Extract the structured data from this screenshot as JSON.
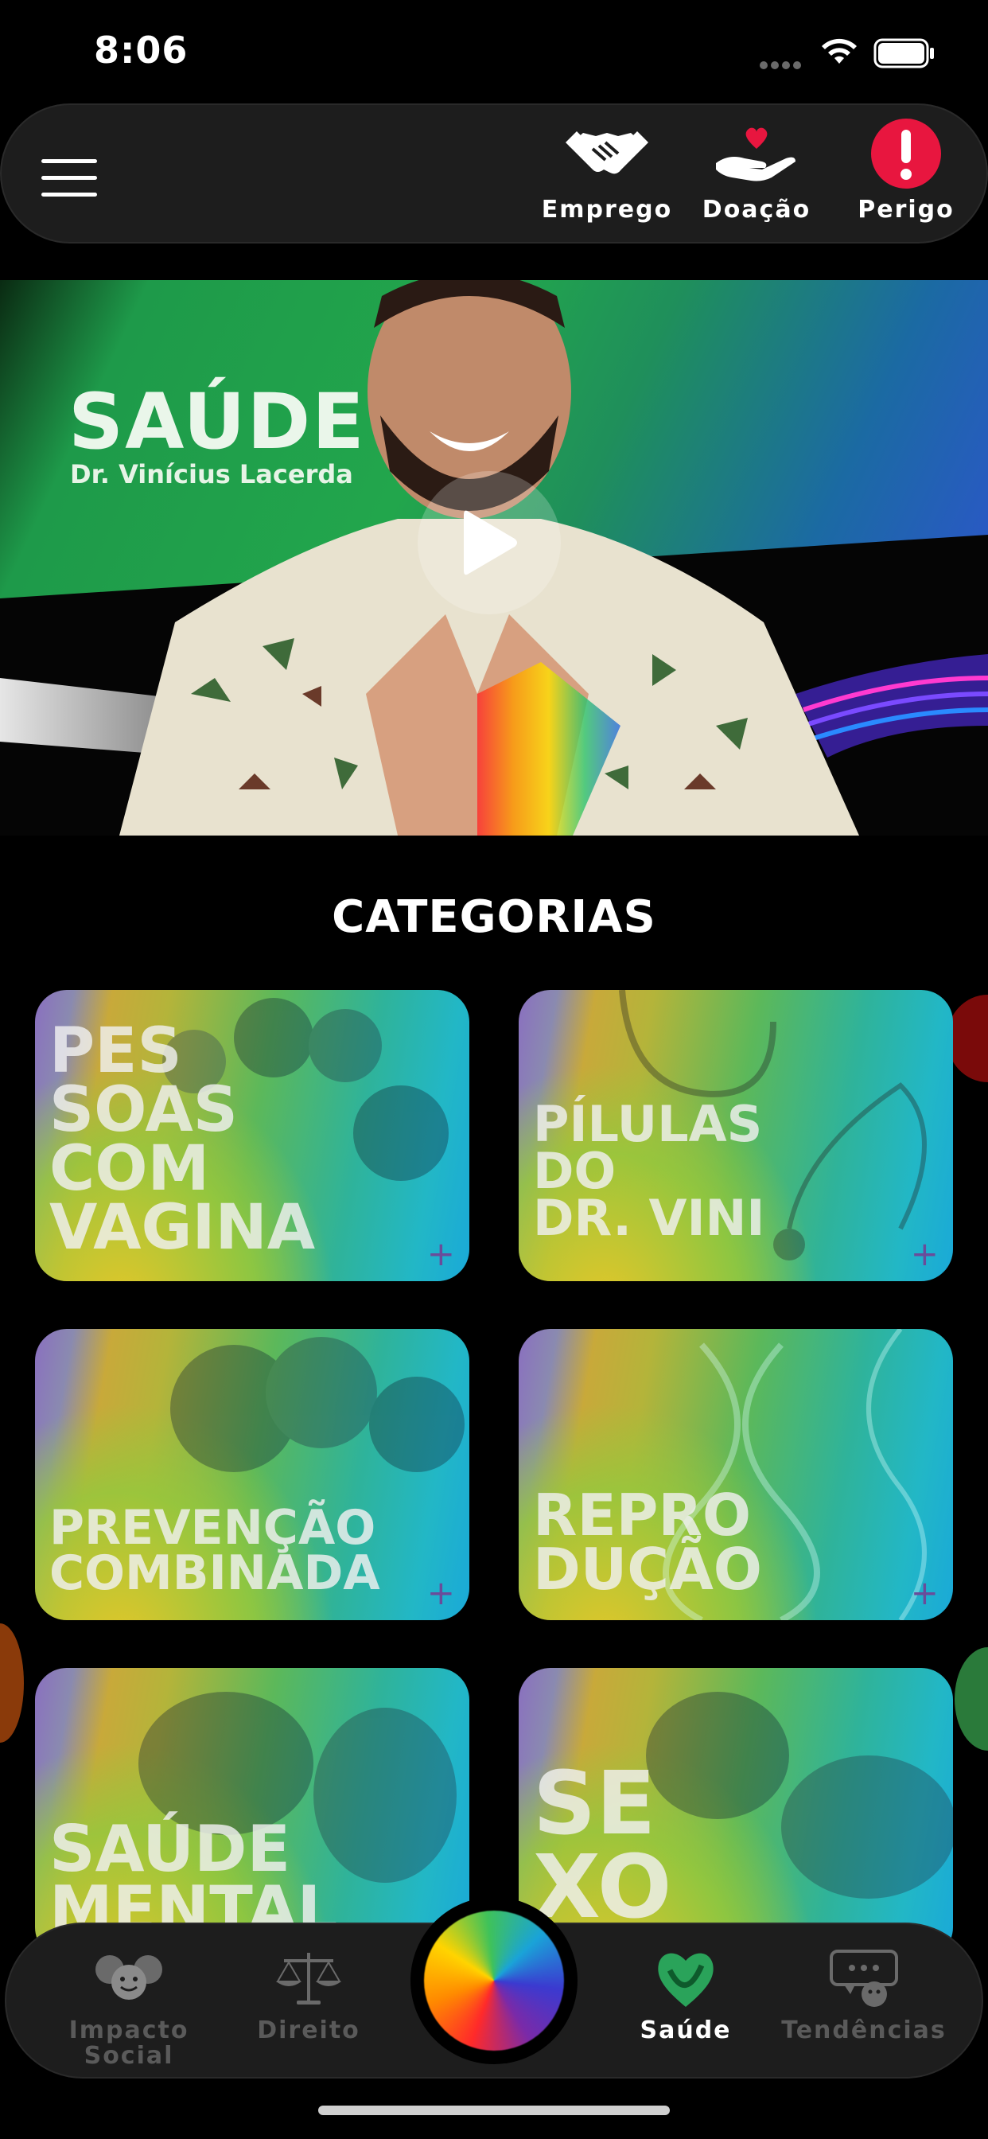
{
  "status": {
    "time": "8:06"
  },
  "top_bar": {
    "actions": [
      {
        "label": "Emprego",
        "icon": "handshake-icon"
      },
      {
        "label": "Doação",
        "icon": "donation-hand-heart-icon"
      },
      {
        "label": "Perigo",
        "icon": "danger-exclamation-icon"
      }
    ]
  },
  "hero": {
    "title": "SAÚDE",
    "subtitle": "Dr. Vinícius Lacerda",
    "accent": "#22a64c"
  },
  "section": {
    "title": "CATEGORIAS"
  },
  "categories": [
    {
      "title": "PES\nSOAS\nCOM\nVAGINA"
    },
    {
      "title": "PÍLULAS\nDO\nDR. VINI"
    },
    {
      "title": "PREVENÇÃO\nCOMBINADA"
    },
    {
      "title": "REPRO\nDUÇÃO"
    },
    {
      "title": "SAÚDE\nMENTAL"
    },
    {
      "title": "SE\nXO"
    }
  ],
  "bottom_nav": {
    "items": [
      {
        "label": "Impacto\nSocial",
        "icon": "social-impact-icon",
        "active": false
      },
      {
        "label": "Direito",
        "icon": "scales-icon",
        "active": false
      },
      {
        "label": "Saúde",
        "icon": "health-heart-icon",
        "active": true
      },
      {
        "label": "Tendências",
        "icon": "trends-chat-icon",
        "active": false
      }
    ],
    "center_icon": "rainbow-orb-icon"
  }
}
